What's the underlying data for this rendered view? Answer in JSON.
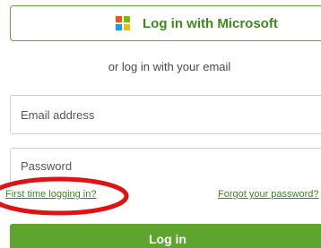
{
  "microsoft_login": {
    "label": "Log in with Microsoft",
    "logo_colors": [
      "#f25022",
      "#7fba00",
      "#00a4ef",
      "#ffb900"
    ]
  },
  "divider_text": "or log in with your email",
  "form": {
    "email_placeholder": "Email address",
    "password_placeholder": "Password"
  },
  "links": {
    "first_time": "First time logging in?",
    "forgot_password": "Forgot your password?"
  },
  "submit": {
    "label": "Log in"
  },
  "colors": {
    "brand_green": "#5da52f",
    "link_green": "#3a8a1c",
    "annotation_red": "#e01212"
  }
}
